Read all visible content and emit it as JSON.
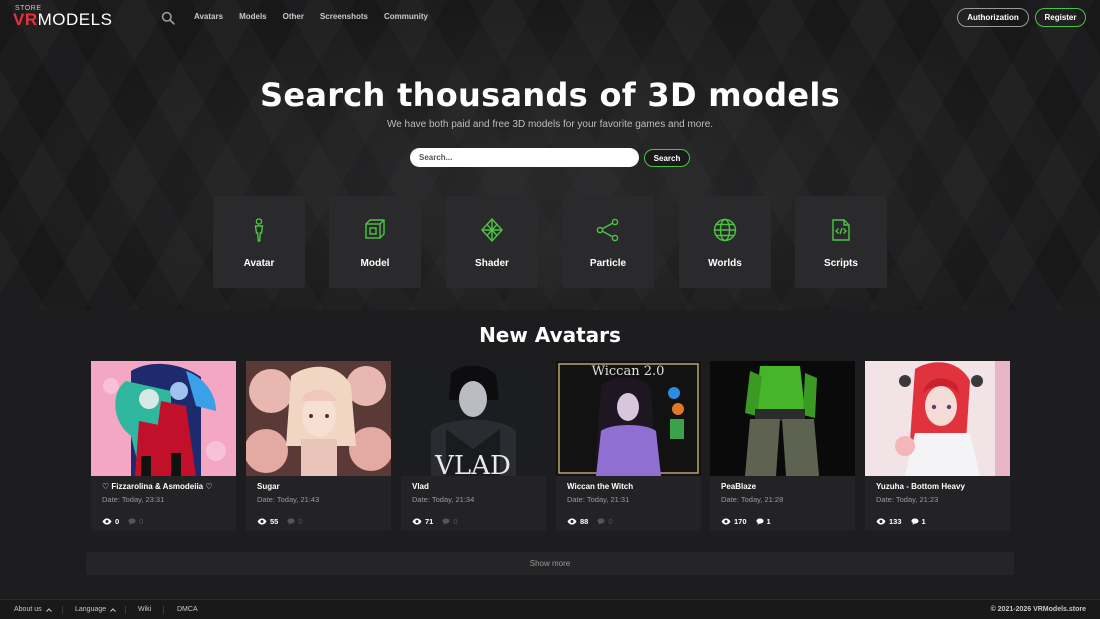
{
  "brand": {
    "logo_top": "STORE",
    "logo_vr": "VR",
    "logo_rest": "MODELS",
    "accent": "#4cc443",
    "logo_red": "#e8313b"
  },
  "nav": {
    "items": [
      "Avatars",
      "Models",
      "Other",
      "Screenshots",
      "Community"
    ],
    "authorization": "Authorization",
    "register": "Register"
  },
  "hero": {
    "title": "Search thousands of 3D models",
    "subtitle": "We have both paid and free 3D models for your favorite games and more.",
    "search_placeholder": "Search...",
    "search_button": "Search"
  },
  "categories": [
    {
      "label": "Avatar",
      "icon": "person-icon"
    },
    {
      "label": "Model",
      "icon": "cube-icon"
    },
    {
      "label": "Shader",
      "icon": "diamond-icon"
    },
    {
      "label": "Particle",
      "icon": "share-nodes-icon"
    },
    {
      "label": "Worlds",
      "icon": "globe-icon"
    },
    {
      "label": "Scripts",
      "icon": "code-file-icon"
    }
  ],
  "new_avatars": {
    "title": "New Avatars",
    "cards": [
      {
        "title": "♡ Fizzarolina & Asmodeiia ♡",
        "date": "Date: Today, 23:31",
        "views": "0",
        "comments": "0"
      },
      {
        "title": "Sugar",
        "date": "Date: Today, 21:43",
        "views": "55",
        "comments": "0"
      },
      {
        "title": "Vlad",
        "date": "Date: Today, 21:34",
        "views": "71",
        "comments": "0"
      },
      {
        "title": "Wiccan the Witch",
        "date": "Date: Today, 21:31",
        "views": "88",
        "comments": "0"
      },
      {
        "title": "PeaBlaze",
        "date": "Date: Today, 21:28",
        "views": "170",
        "comments": "1"
      },
      {
        "title": "Yuzuha - Bottom Heavy",
        "date": "Date: Today, 21:23",
        "views": "133",
        "comments": "1"
      }
    ],
    "thumb_texts": [
      "VLAD",
      "Wiccan 2.0"
    ],
    "show_more": "Show more"
  },
  "footer": {
    "about": "About us",
    "language": "Language",
    "wiki": "Wiki",
    "dmca": "DMCA",
    "copyright": "© 2021-2026 VRModels.store"
  }
}
